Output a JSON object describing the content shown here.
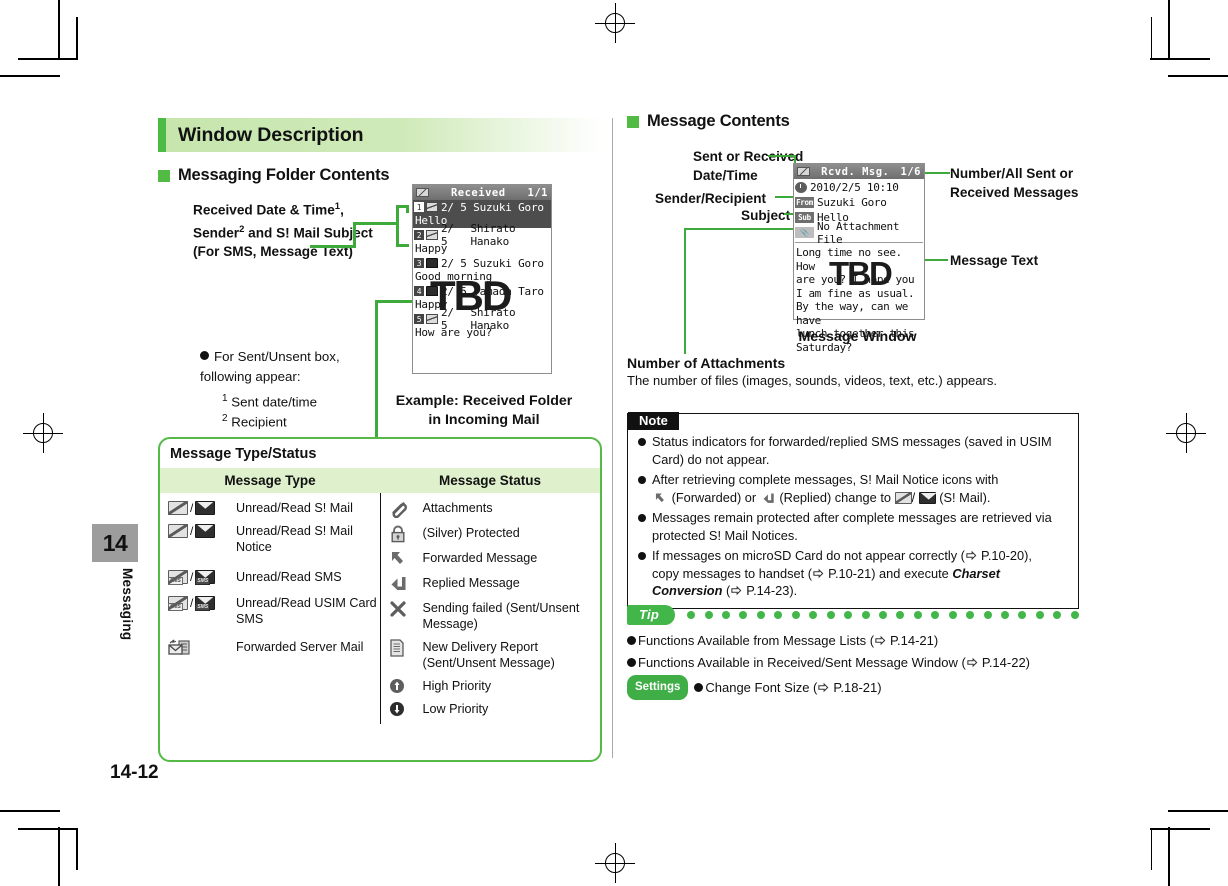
{
  "page": {
    "chapter_number": "14",
    "chapter_name": "Messaging",
    "folio": "14-12"
  },
  "left": {
    "section_title": "Window Description",
    "subsection_title": "Messaging Folder Contents",
    "annotation": {
      "line1": "Received Date & Time",
      "sup1": "1",
      "line2a": "Sender",
      "sup2": "2",
      "line2b": " and S! Mail Subject",
      "line3": "(For SMS, Message Text)"
    },
    "note": {
      "lead": "For Sent/Unsent box, following appear:",
      "foot1_marker": "1",
      "foot1": "Sent date/time",
      "foot2_marker": "2",
      "foot2": "Recipient"
    },
    "caption_line1": "Example: Received Folder",
    "caption_line2": "in Incoming Mail",
    "screen": {
      "title": "Received",
      "counter": "1/1",
      "rows": [
        {
          "num": "1",
          "icon": "envelope-open-icon",
          "date": "2/ 5",
          "name": "Suzuki Goro",
          "preview": "Hello",
          "selected": true
        },
        {
          "num": "2",
          "icon": "envelope-open-icon",
          "date": "2/ 5",
          "name": "Shirato Hanako",
          "preview": "Happy",
          "selected": false
        },
        {
          "num": "3",
          "icon": "envelope-read-icon",
          "date": "2/ 5",
          "name": "Suzuki Goro",
          "preview": "Good morning",
          "selected": false
        },
        {
          "num": "4",
          "icon": "envelope-read-icon",
          "date": "2/ 5",
          "name": "Yamada Taro",
          "preview": "Happy",
          "selected": false
        },
        {
          "num": "5",
          "icon": "envelope-open-icon",
          "date": "2/ 5",
          "name": "Shirato Hanako",
          "preview": "How are you?",
          "selected": false
        }
      ],
      "overlay": "TBD"
    }
  },
  "table": {
    "title": "Message Type/Status",
    "headers": [
      "Message Type",
      "Message Status"
    ],
    "type_rows": [
      {
        "icons": "envelope-unread-read-icon",
        "label": "Unread/Read S! Mail"
      },
      {
        "icons": "envelope-notice-icon",
        "label": "Unread/Read S! Mail Notice"
      },
      {
        "icons": "envelope-sms-icon",
        "label": "Unread/Read SMS"
      },
      {
        "icons": "envelope-usim-sms-icon",
        "label": "Unread/Read USIM Card SMS"
      },
      {
        "icons": "forwarded-server-mail-icon",
        "label": "Forwarded Server Mail"
      }
    ],
    "status_rows": [
      {
        "icon": "paperclip-icon",
        "label": "Attachments"
      },
      {
        "icon": "lock-icon",
        "label": "(Silver) Protected"
      },
      {
        "icon": "forward-arrow-icon",
        "label": "Forwarded Message"
      },
      {
        "icon": "reply-arrow-icon",
        "label": "Replied Message"
      },
      {
        "icon": "cross-icon",
        "label": "Sending failed (Sent/Unsent Message)"
      },
      {
        "icon": "document-icon",
        "label": "New Delivery Report (Sent/Unsent Message)"
      },
      {
        "icon": "high-priority-icon",
        "label": "High Priority"
      },
      {
        "icon": "low-priority-icon",
        "label": "Low Priority"
      }
    ]
  },
  "right": {
    "subsection_title": "Message Contents",
    "labels": {
      "sent_received": "Sent or Received\nDate/Time",
      "sent_received_l1": "Sent or Received",
      "sent_received_l2": "Date/Time",
      "sender_recipient": "Sender/Recipient",
      "subject": "Subject",
      "number_all_l1": "Number/All Sent or",
      "number_all_l2": "Received Messages",
      "message_text": "Message Text",
      "window_caption": "Message Window"
    },
    "attachments": {
      "heading": "Number of Attachments",
      "text": "The number of files (images, sounds, videos, text, etc.) appears."
    },
    "screen": {
      "title": "Rcvd. Msg.",
      "counter": "1/6",
      "datetime": "2010/2/5 10:10",
      "from_tag": "From",
      "from": "Suzuki Goro",
      "sub_tag": "Sub",
      "subject": "Hello",
      "attach": "No Attachment File",
      "body_lines": [
        "Long time no see. How",
        "are you? I hope you",
        "I am fine as usual.",
        "By the way, can we have",
        " lunch together this",
        "Saturday?"
      ],
      "overlay": "TBD"
    }
  },
  "note": {
    "tag": "Note",
    "items": [
      {
        "text": "Status indicators for forwarded/replied SMS messages (saved in USIM Card) do not appear."
      },
      {
        "text": "After retrieving complete messages, S! Mail Notice icons with (Forwarded) or (Replied) change to / (S! Mail).",
        "part1": "After retrieving complete messages, S! Mail Notice icons with",
        "part2": "(Forwarded) or",
        "part3": "(Replied) change to",
        "part4": "(S! Mail)."
      },
      {
        "text": "Messages remain protected after complete messages are retrieved via protected S! Mail Notices."
      },
      {
        "text": "If messages on microSD Card do not appear correctly (",
        "ref1": "P.10-20),",
        "mid": "copy messages to handset (",
        "ref2": "P.10-21) and execute ",
        "emph": "Charset Conversion",
        "ref3": "P.14-23)."
      }
    ]
  },
  "tip": {
    "badge": "Tip",
    "settings_badge": "Settings",
    "items": [
      {
        "label": "Functions Available from Message Lists (",
        "ref": "P.14-21)",
        "settings": false
      },
      {
        "label": "Functions Available in Received/Sent Message Window (",
        "ref": "P.14-22)",
        "settings": false
      },
      {
        "label": "Change Font Size (",
        "ref": "P.18-21)",
        "settings": true
      }
    ]
  },
  "colors": {
    "accent_green": "#4cbb46",
    "header_green": "#c6e6ad",
    "table_header_green": "#dff0cd",
    "connector_green": "#3faa3c",
    "tab_gray": "#9d9d9d"
  }
}
